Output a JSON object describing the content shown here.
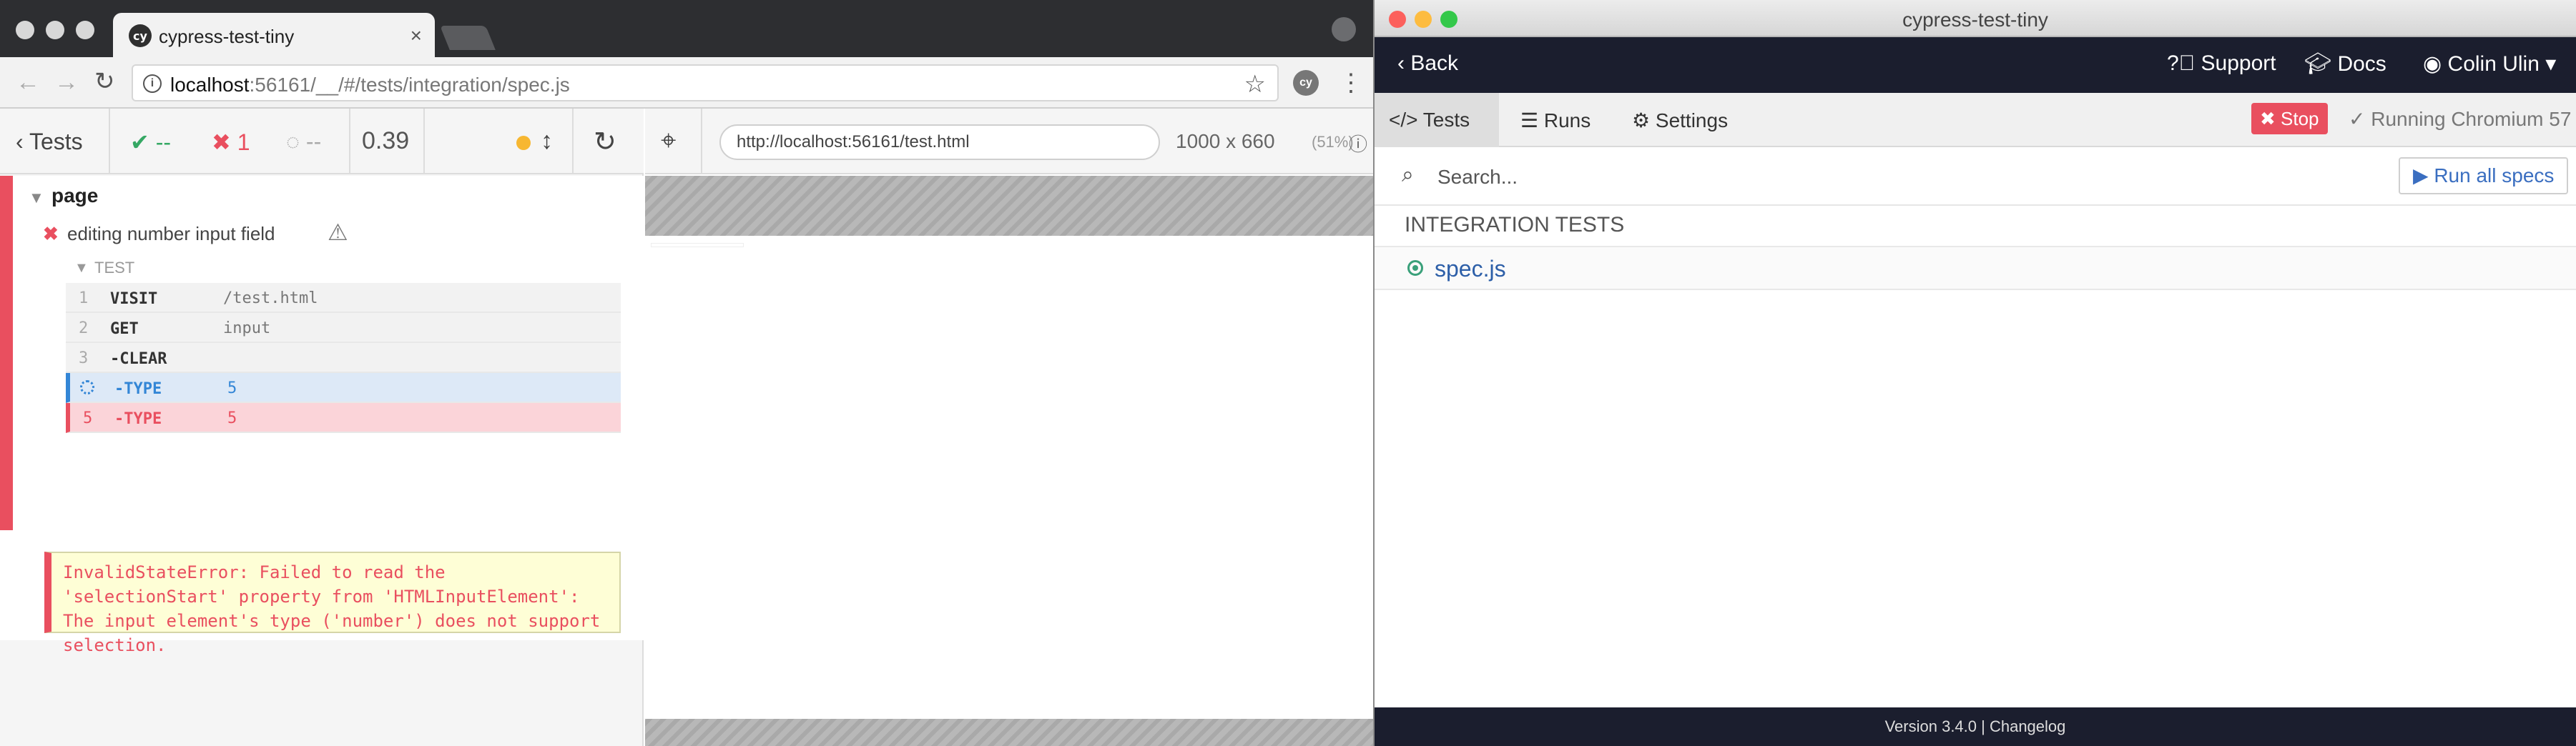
{
  "chrome": {
    "tab_title": "cypress-test-tiny",
    "tab_close": "×",
    "favicon_text": "cy",
    "address": {
      "host": "localhost",
      "rest": ":56161/__/#/tests/integration/spec.js"
    },
    "info_icon_text": "i",
    "extension_text": "cy"
  },
  "reporter": {
    "tests_label": "Tests",
    "passed_count": "--",
    "failed_count": "1",
    "pending_count": "--",
    "duration": "0.39",
    "suite_title": "page",
    "test_title": "editing number input field",
    "hooks_title": "TEST",
    "commands": [
      {
        "number": "1",
        "name": "VISIT",
        "message": "/test.html",
        "state": "passed"
      },
      {
        "number": "2",
        "name": "GET",
        "message": "input",
        "state": "passed"
      },
      {
        "number": "3",
        "name": "-CLEAR",
        "message": "",
        "state": "passed"
      },
      {
        "number": "",
        "name": "-TYPE",
        "message": "5",
        "state": "pending"
      },
      {
        "number": "5",
        "name": "-TYPE",
        "message": "5",
        "state": "failed"
      }
    ],
    "error_message": "InvalidStateError: Failed to read the 'selectionStart' property from 'HTMLInputElement': The input element's type ('number') does not support selection."
  },
  "aut": {
    "url": "http://localhost:56161/test.html",
    "viewport_size": "1000 x 660",
    "viewport_scale": "(51%)"
  },
  "desktop": {
    "window_title": "cypress-test-tiny",
    "back_label": "Back",
    "support_label": "Support",
    "docs_label": "Docs",
    "user_name": "Colin Ulin",
    "tabs": [
      "Tests",
      "Runs",
      "Settings"
    ],
    "stop_label": "Stop",
    "browser_status": "Running Chromium 57",
    "search_placeholder": "Search...",
    "run_all_label": "Run all specs",
    "specs_heading": "INTEGRATION TESTS",
    "spec_name": "spec.js",
    "footer": "Version 3.4.0 | Changelog"
  },
  "colors": {
    "fail": "#e94f5f",
    "pass": "#35a864",
    "pending": "#3386d6",
    "nav_dark": "#1b1e2e",
    "link_blue": "#2d5fa8"
  }
}
